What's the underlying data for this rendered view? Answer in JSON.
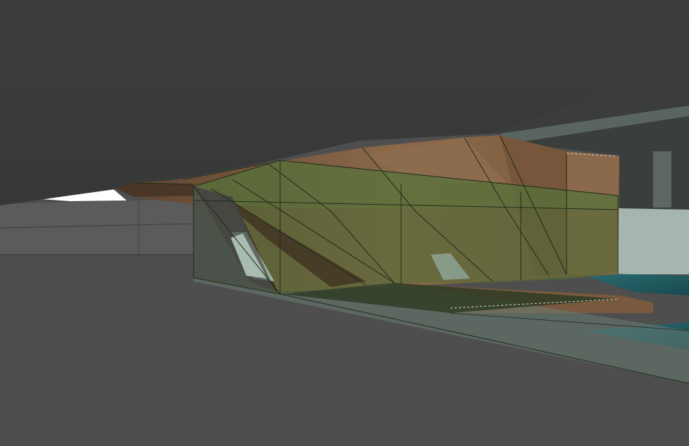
{
  "scene": {
    "kind": "3d-architectural-viewport",
    "colors": {
      "sky_ceiling": "#3b3c3b",
      "ground": "#4e4e4e",
      "far_wall": "#5c5c5c",
      "wood": "#7a5a3e",
      "wood_dark": "#5a4030",
      "glass_green": "#4f6b34",
      "glass_edge": "#1f2a1a",
      "water": "#1f5c63",
      "pale_glass": "#8ea79a",
      "white_gap": "#ffffff"
    }
  }
}
